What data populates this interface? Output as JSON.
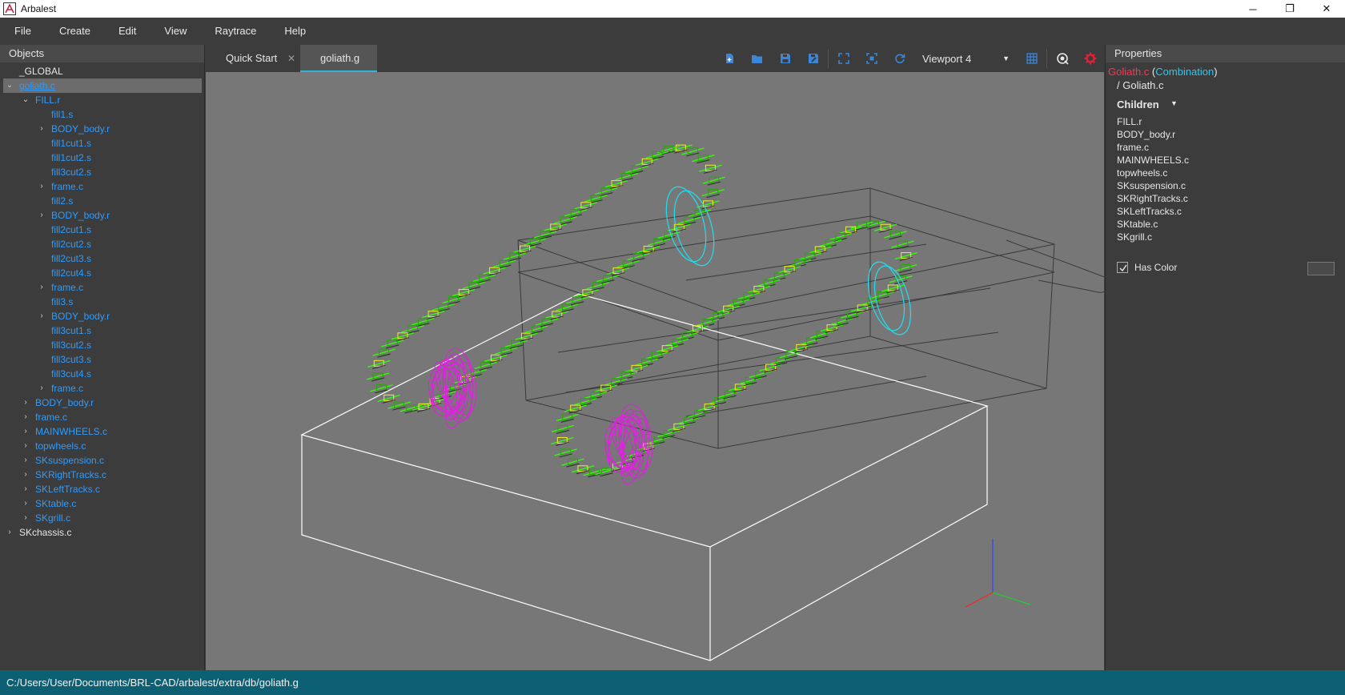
{
  "window": {
    "title": "Arbalest",
    "minimize": "─",
    "maximize": "❐",
    "close": "✕"
  },
  "menu": [
    "File",
    "Create",
    "Edit",
    "View",
    "Raytrace",
    "Help"
  ],
  "objects_panel": {
    "title": "Objects",
    "tree": [
      {
        "label": "_GLOBAL",
        "indent": 0,
        "arrow": "",
        "color": "white"
      },
      {
        "label": "goliath.c",
        "indent": 0,
        "arrow": "⌄",
        "color": "selected"
      },
      {
        "label": "FILL.r",
        "indent": 1,
        "arrow": "⌄",
        "color": "blue"
      },
      {
        "label": "fill1.s",
        "indent": 2,
        "arrow": "",
        "color": "blue"
      },
      {
        "label": "BODY_body.r",
        "indent": 2,
        "arrow": "›",
        "color": "blue"
      },
      {
        "label": "fill1cut1.s",
        "indent": 2,
        "arrow": "",
        "color": "blue"
      },
      {
        "label": "fill1cut2.s",
        "indent": 2,
        "arrow": "",
        "color": "blue"
      },
      {
        "label": "fill3cut2.s",
        "indent": 2,
        "arrow": "",
        "color": "blue"
      },
      {
        "label": "frame.c",
        "indent": 2,
        "arrow": "›",
        "color": "blue"
      },
      {
        "label": "fill2.s",
        "indent": 2,
        "arrow": "",
        "color": "blue"
      },
      {
        "label": "BODY_body.r",
        "indent": 2,
        "arrow": "›",
        "color": "blue"
      },
      {
        "label": "fill2cut1.s",
        "indent": 2,
        "arrow": "",
        "color": "blue"
      },
      {
        "label": "fill2cut2.s",
        "indent": 2,
        "arrow": "",
        "color": "blue"
      },
      {
        "label": "fill2cut3.s",
        "indent": 2,
        "arrow": "",
        "color": "blue"
      },
      {
        "label": "fill2cut4.s",
        "indent": 2,
        "arrow": "",
        "color": "blue"
      },
      {
        "label": "frame.c",
        "indent": 2,
        "arrow": "›",
        "color": "blue"
      },
      {
        "label": "fill3.s",
        "indent": 2,
        "arrow": "",
        "color": "blue"
      },
      {
        "label": "BODY_body.r",
        "indent": 2,
        "arrow": "›",
        "color": "blue"
      },
      {
        "label": "fill3cut1.s",
        "indent": 2,
        "arrow": "",
        "color": "blue"
      },
      {
        "label": "fill3cut2.s",
        "indent": 2,
        "arrow": "",
        "color": "blue"
      },
      {
        "label": "fill3cut3.s",
        "indent": 2,
        "arrow": "",
        "color": "blue"
      },
      {
        "label": "fill3cut4.s",
        "indent": 2,
        "arrow": "",
        "color": "blue"
      },
      {
        "label": "frame.c",
        "indent": 2,
        "arrow": "›",
        "color": "blue"
      },
      {
        "label": "BODY_body.r",
        "indent": 1,
        "arrow": "›",
        "color": "blue"
      },
      {
        "label": "frame.c",
        "indent": 1,
        "arrow": "›",
        "color": "blue"
      },
      {
        "label": "MAINWHEELS.c",
        "indent": 1,
        "arrow": "›",
        "color": "blue"
      },
      {
        "label": "topwheels.c",
        "indent": 1,
        "arrow": "›",
        "color": "blue"
      },
      {
        "label": "SKsuspension.c",
        "indent": 1,
        "arrow": "›",
        "color": "blue"
      },
      {
        "label": "SKRightTracks.c",
        "indent": 1,
        "arrow": "›",
        "color": "blue"
      },
      {
        "label": "SKLeftTracks.c",
        "indent": 1,
        "arrow": "›",
        "color": "blue"
      },
      {
        "label": "SKtable.c",
        "indent": 1,
        "arrow": "›",
        "color": "blue"
      },
      {
        "label": "SKgrill.c",
        "indent": 1,
        "arrow": "›",
        "color": "blue"
      },
      {
        "label": "SKchassis.c",
        "indent": 0,
        "arrow": "›",
        "color": "white"
      }
    ]
  },
  "tabs": [
    {
      "label": "Quick Start",
      "close": "✕",
      "active": false
    },
    {
      "label": "goliath.g",
      "close": "",
      "active": true
    }
  ],
  "toolbar": {
    "viewport_label": "Viewport 4",
    "icons": [
      "new-file-icon",
      "open-folder-icon",
      "save-icon",
      "save-as-icon",
      "fullscreen-icon",
      "fit-view-icon",
      "reset-view-icon",
      "grid-icon",
      "raytrace-icon",
      "settings-icon"
    ]
  },
  "properties": {
    "title": "Properties",
    "object_name": "Goliath.c",
    "object_type": "Combination",
    "path": "/ Goliath.c",
    "children_header": "Children",
    "children": [
      "FILL.r",
      "BODY_body.r",
      "frame.c",
      "MAINWHEELS.c",
      "topwheels.c",
      "SKsuspension.c",
      "SKRightTracks.c",
      "SKLeftTracks.c",
      "SKtable.c",
      "SKgrill.c"
    ],
    "has_color_label": "Has Color",
    "has_color_checked": true
  },
  "statusbar": {
    "path": "C:/Users/User/Documents/BRL-CAD/arbalest/extra/db/goliath.g"
  },
  "colors": {
    "accent": "#2fb6d6",
    "tree_blue": "#2e9cff",
    "name_red": "#ff3355",
    "type_cyan": "#2fc6f0",
    "status_bg": "#0d6073",
    "viewport_bg": "#777777",
    "track_green": "#33ff00",
    "wheel_magenta": "#e020e0",
    "wheel_cyan": "#22ddee"
  }
}
